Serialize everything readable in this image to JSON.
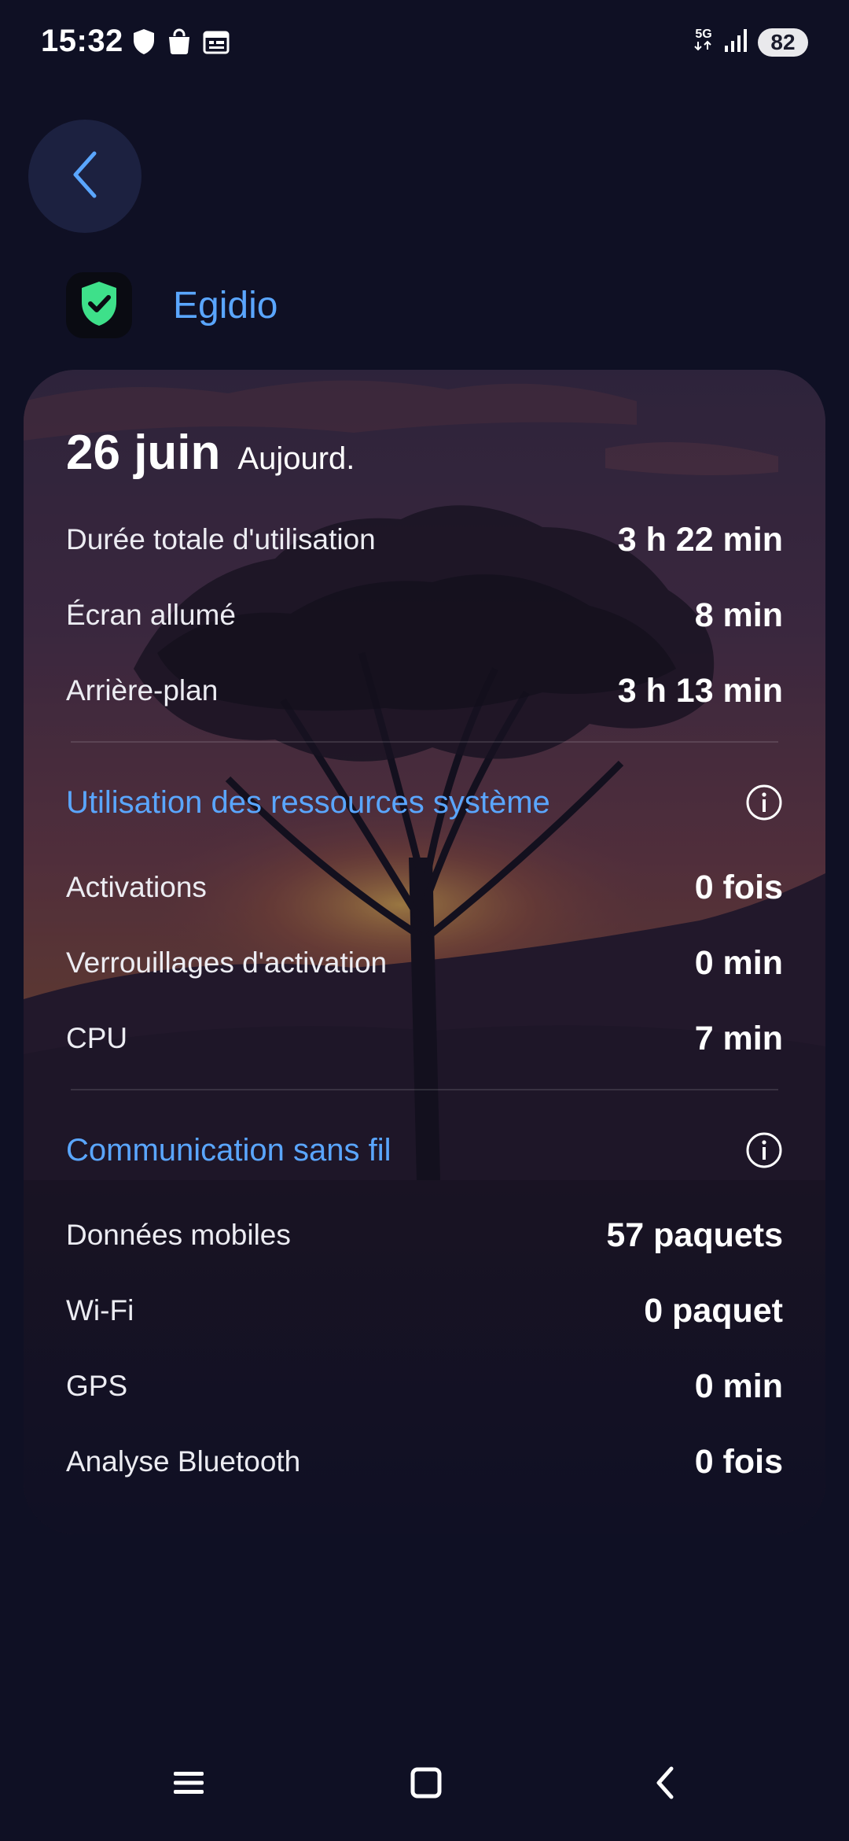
{
  "status_bar": {
    "time": "15:32",
    "network": "5G",
    "battery": "82",
    "left_icons": [
      "shield-icon",
      "shopping-bag-icon",
      "calendar-icon"
    ],
    "right_icons": [
      "signal-icon"
    ]
  },
  "header": {
    "back_icon": "chevron-left-icon",
    "app_icon": "shield-check-icon",
    "app_name": "Egidio"
  },
  "card": {
    "date": "26 juin",
    "date_sub": "Aujourd.",
    "usage": [
      {
        "label": "Durée totale d'utilisation",
        "value": "3 h 22 min"
      },
      {
        "label": "Écran allumé",
        "value": "8 min"
      },
      {
        "label": "Arrière-plan",
        "value": "3 h 13 min"
      }
    ],
    "resources": {
      "title": "Utilisation des ressources système",
      "rows": [
        {
          "label": "Activations",
          "value": "0 fois"
        },
        {
          "label": "Verrouillages d'activation",
          "value": "0 min"
        },
        {
          "label": "CPU",
          "value": "7 min"
        }
      ]
    },
    "wireless": {
      "title": "Communication sans fil",
      "rows": [
        {
          "label": "Données mobiles",
          "value": "57 paquets"
        },
        {
          "label": "Wi-Fi",
          "value": "0 paquet"
        },
        {
          "label": "GPS",
          "value": "0 min"
        },
        {
          "label": "Analyse Bluetooth",
          "value": "0 fois"
        }
      ]
    }
  },
  "nav_bar": {
    "icons": [
      "menu-icon",
      "home-square-icon",
      "back-chevron-icon"
    ]
  },
  "colors": {
    "background": "#0f1024",
    "accent": "#5aa6ff",
    "app_icon_green": "#3ee08a"
  }
}
